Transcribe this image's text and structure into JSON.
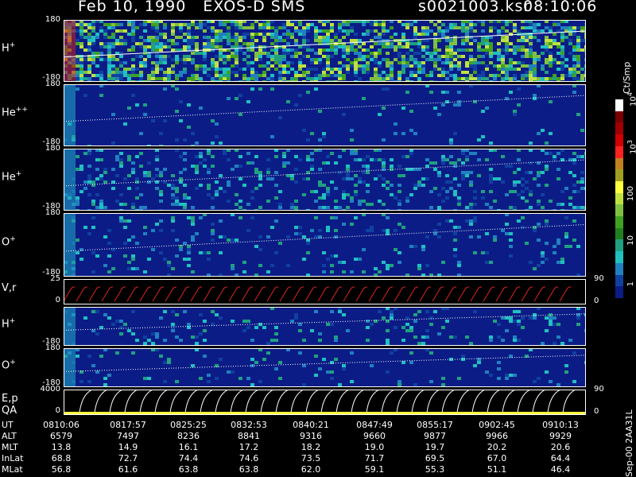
{
  "header": {
    "title": "Feb 10, 1990   EXOS-D SMS",
    "file": "s0021003.ksr",
    "time": "08:10:06"
  },
  "colorbar": {
    "unit_label": "Ct/Smp",
    "ticks": [
      "10",
      "10",
      "100",
      "10",
      "1"
    ],
    "tick_sups": [
      "4",
      "3",
      "",
      "",
      ""
    ],
    "colors": [
      "#ffffff",
      "#7a0000",
      "#a00000",
      "#d00000",
      "#ff2020",
      "#c08020",
      "#a0a020",
      "#ffff40",
      "#c0e040",
      "#80c040",
      "#40a020",
      "#208020",
      "#20a080",
      "#20c0c0",
      "#2080c0",
      "#1040a0",
      "#0b1c86"
    ]
  },
  "panels": [
    {
      "id": "h-plus",
      "label": "H",
      "sup": "+",
      "top_tick": "180",
      "bottom_tick": "-180"
    },
    {
      "id": "he-plus-plus",
      "label": "He",
      "sup": "++",
      "top_tick": "180",
      "bottom_tick": "-180"
    },
    {
      "id": "he-plus",
      "label": "He",
      "sup": "+",
      "top_tick": "180",
      "bottom_tick": "-180"
    },
    {
      "id": "o-plus",
      "label": "O",
      "sup": "+",
      "top_tick": "180",
      "bottom_tick": "-180"
    },
    {
      "id": "v-r",
      "label": "V,r",
      "sup": "",
      "top_tick": "25",
      "bottom_tick": "0",
      "right_top": "90",
      "right_bottom": "0"
    },
    {
      "id": "h-plus-2",
      "label": "H",
      "sup": "+",
      "top_tick": "",
      "bottom_tick": "-180"
    },
    {
      "id": "o-plus-2",
      "label": "O",
      "sup": "+",
      "top_tick": "180",
      "bottom_tick": "-180"
    },
    {
      "id": "ep-qa",
      "label": "E,p",
      "label2": "QA",
      "sup": "",
      "top_tick": "4000",
      "bottom_tick": "0",
      "right_top": "90",
      "right_bottom": "0"
    }
  ],
  "footer_vertical": "Sep-00  2AA31L",
  "table": {
    "rows": [
      {
        "label": "UT",
        "values": [
          "0810:06",
          "0817:57",
          "0825:25",
          "0832:53",
          "0840:21",
          "0847:49",
          "0855:17",
          "0902:45",
          "0910:13"
        ]
      },
      {
        "label": "ALT",
        "values": [
          "6579",
          "7497",
          "8236",
          "8841",
          "9316",
          "9660",
          "9877",
          "9966",
          "9929"
        ]
      },
      {
        "label": "MLT",
        "values": [
          "13.8",
          "14.9",
          "16.1",
          "17.2",
          "18.2",
          "19.0",
          "19.7",
          "20.2",
          "20.6"
        ]
      },
      {
        "label": "InLat",
        "values": [
          "68.8",
          "72.7",
          "74.4",
          "74.6",
          "73.5",
          "71.7",
          "69.5",
          "67.0",
          "64.4"
        ]
      },
      {
        "label": "MLat",
        "values": [
          "56.8",
          "61.6",
          "63.8",
          "63.8",
          "62.0",
          "59.1",
          "55.3",
          "51.1",
          "46.4"
        ]
      }
    ]
  },
  "chart_data": {
    "type": "heatmap",
    "title": "Feb 10, 1990   EXOS-D SMS",
    "x_tick_labels": [
      "0810:06",
      "0817:57",
      "0825:25",
      "0832:53",
      "0840:21",
      "0847:49",
      "0855:17",
      "0902:45",
      "0910:13"
    ],
    "colorbar_label": "Ct/Smp",
    "colorbar_scale": "log",
    "colorbar_range": [
      1,
      10000
    ],
    "panels": [
      {
        "label": "H+",
        "ylim": [
          -180,
          180
        ]
      },
      {
        "label": "He++",
        "ylim": [
          -180,
          180
        ]
      },
      {
        "label": "He+",
        "ylim": [
          -180,
          180
        ]
      },
      {
        "label": "O+",
        "ylim": [
          -180,
          180
        ]
      },
      {
        "label": "V,r",
        "ylim": [
          0,
          25
        ],
        "y2lim": [
          0,
          90
        ]
      },
      {
        "label": "H+",
        "ylim": [
          -180,
          180
        ]
      },
      {
        "label": "O+",
        "ylim": [
          -180,
          180
        ]
      },
      {
        "label": "E,p QA",
        "ylim": [
          0,
          4000
        ],
        "y2lim": [
          0,
          90
        ]
      }
    ]
  }
}
